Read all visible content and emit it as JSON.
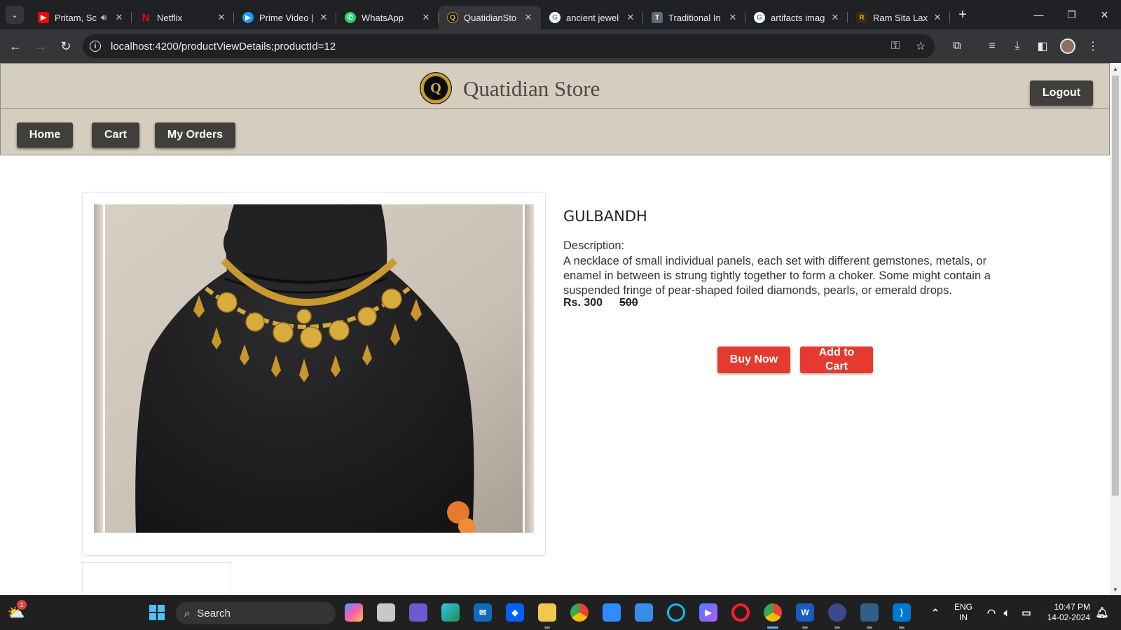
{
  "browser": {
    "tabs": [
      {
        "title": "Pritam, Sc",
        "favicon_color": "#ff0000",
        "favicon_glyph": "▶",
        "has_audio": true,
        "active": false
      },
      {
        "title": "Netflix",
        "favicon_color": "#e50914",
        "favicon_glyph": "N",
        "active": false
      },
      {
        "title": "Prime Video |",
        "favicon_color": "#1a98ff",
        "favicon_glyph": "▶",
        "active": false
      },
      {
        "title": "WhatsApp",
        "favicon_color": "#25d366",
        "favicon_glyph": "✆",
        "active": false
      },
      {
        "title": "QuatidianSto",
        "favicon_color": "#1a1a1a",
        "favicon_glyph": "Q",
        "active": true
      },
      {
        "title": "ancient jewel",
        "favicon_color": "#ffffff",
        "favicon_glyph": "G",
        "active": false
      },
      {
        "title": "Traditional In",
        "favicon_color": "#5a6a7a",
        "favicon_glyph": "T",
        "active": false
      },
      {
        "title": "artifacts imag",
        "favicon_color": "#ffffff",
        "favicon_glyph": "G",
        "active": false
      },
      {
        "title": "Ram Sita Lax",
        "favicon_color": "#3a2a10",
        "favicon_glyph": "R",
        "active": false
      }
    ],
    "address": "localhost:4200/productViewDetails;productId=12"
  },
  "store": {
    "logo_letter": "Q",
    "title": "Quatidian Store",
    "logout_label": "Logout",
    "nav": [
      {
        "label": "Home"
      },
      {
        "label": "Cart"
      },
      {
        "label": "My Orders"
      }
    ]
  },
  "product": {
    "name": "GULBANDH",
    "description_label": "Description:",
    "description": "A necklace of small individual panels, each set with different gemstones, metals, or enamel in between is strung tightly together to form a choker. Some might contain a suspended fringe of pear-shaped foiled diamonds, pearls, or emerald drops.",
    "price": "Rs. 300",
    "original_price": "500",
    "buy_now_label": "Buy Now",
    "add_to_cart_label": "Add to Cart"
  },
  "taskbar": {
    "search_placeholder": "Search",
    "weather_badge": "1",
    "language": "ENG",
    "region": "IN",
    "time": "10:47 PM",
    "date": "14-02-2024"
  },
  "colors": {
    "header_bg": "#d5cdbe",
    "nav_button": "#403f3c",
    "action_button": "#e53a2f"
  }
}
